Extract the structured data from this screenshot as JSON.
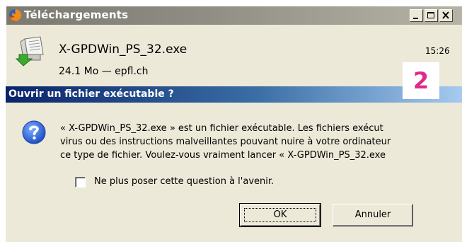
{
  "downloads_window": {
    "title": "Téléchargements",
    "title_icon": "firefox-logo-icon",
    "controls": [
      "minimize-icon",
      "maximize-icon",
      "close-icon"
    ],
    "item": {
      "file_icon": "download-file-icon",
      "filename": "X-GPDWin_PS_32.exe",
      "time": "15:26",
      "meta": "24.1 Mo — epfl.ch"
    }
  },
  "step_badge": "2",
  "dialog": {
    "title": "Ouvrir un fichier exécutable ?",
    "icon": "question-icon",
    "message_lines": [
      "« X-GPDWin_PS_32.exe » est un fichier exécutable. Les fichiers exécut",
      "virus ou des instructions malveillantes pouvant nuire à votre ordinateur",
      "ce type de fichier. Voulez-vous vraiment lancer « X-GPDWin_PS_32.exe"
    ],
    "checkbox": {
      "label": "Ne plus poser cette question à l'avenir.",
      "checked": false
    },
    "buttons": {
      "ok": "OK",
      "cancel": "Annuler"
    }
  },
  "colors": {
    "dialog_title_start": "#0a246a",
    "dialog_title_end": "#a6caf0",
    "window_face": "#ece9d8",
    "badge": "#e0298a"
  }
}
